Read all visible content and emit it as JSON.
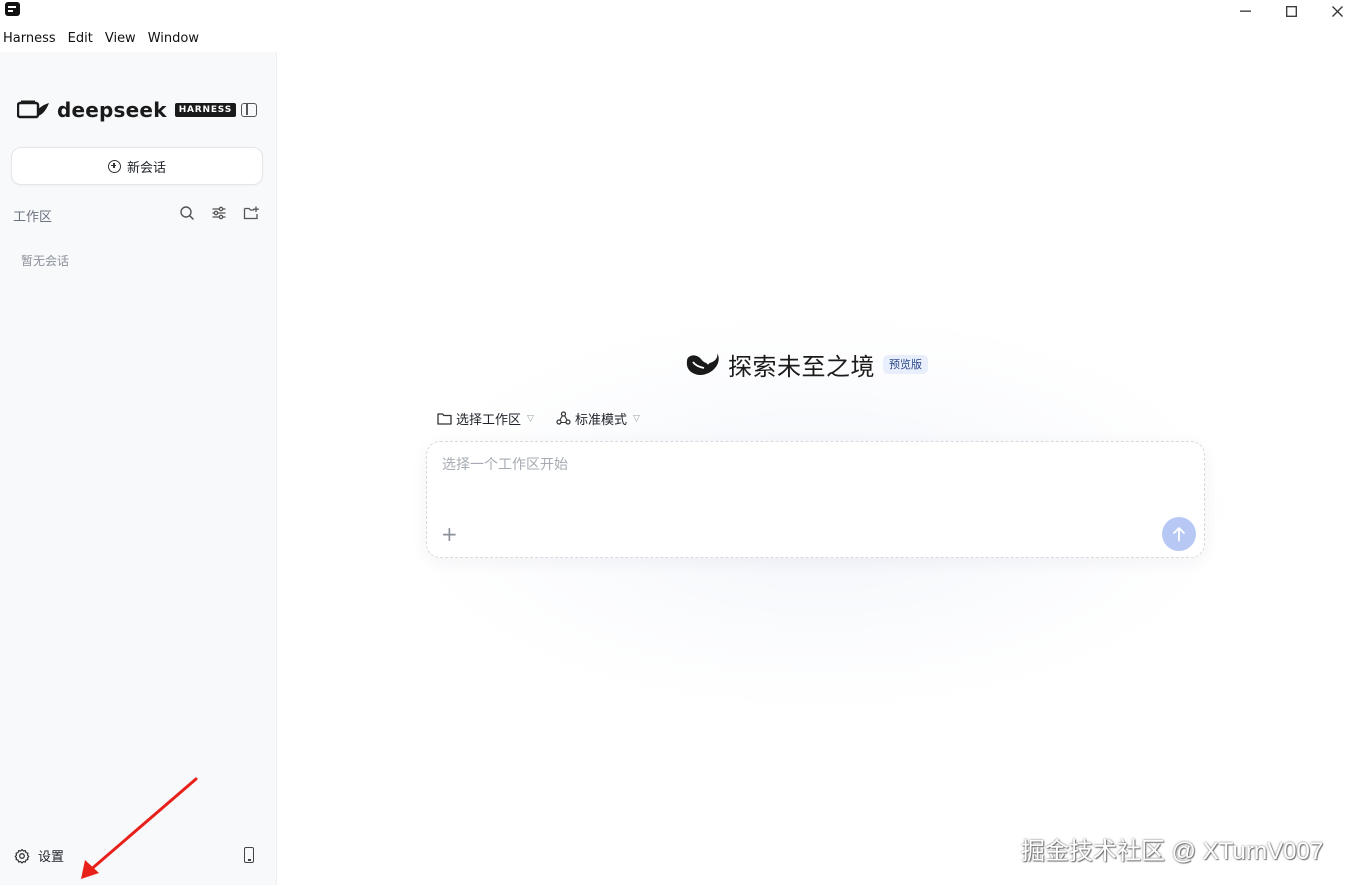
{
  "menubar": {
    "items": [
      "Harness",
      "Edit",
      "View",
      "Window"
    ]
  },
  "window_controls": {
    "minimize": "—",
    "maximize": "☐",
    "close": "✕"
  },
  "sidebar": {
    "logo_text": "deepseek",
    "logo_badge": "HARNESS",
    "new_chat_label": "新会话",
    "workspace_label": "工作区",
    "empty_text": "暂无会话",
    "settings_label": "设置"
  },
  "main": {
    "hero_title": "探索未至之境",
    "preview_badge": "预览版",
    "workspace_select": "选择工作区",
    "mode_select": "标准模式",
    "input_placeholder": "选择一个工作区开始"
  },
  "watermark": "掘金技术社区 @ XTurnV007",
  "colors": {
    "accent": "#b7c8f5",
    "badge_bg": "#e8eefb",
    "badge_text": "#2b4a8a",
    "annotation_arrow": "#e8201a"
  }
}
